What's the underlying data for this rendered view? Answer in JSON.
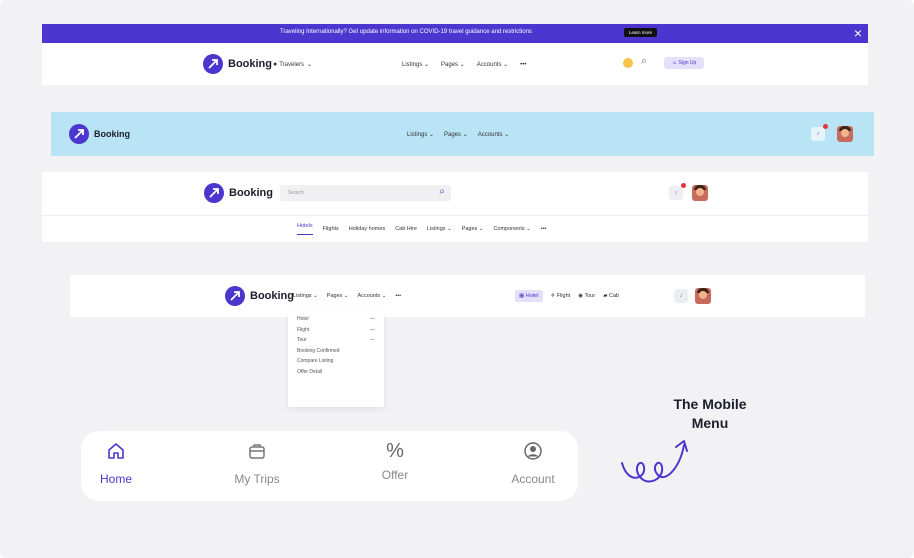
{
  "banner": {
    "text": "Traveling Internationally? Get update information on COVID-19 travel guidance and restrictions",
    "learn_more": "Learn more",
    "close_glyph": "×",
    "bg_color": "#4b37cf"
  },
  "brand": {
    "name": "Booking",
    "accent": "#4b37cf"
  },
  "header1": {
    "travelers": "Travelers",
    "nav": [
      "Listings",
      "Pages",
      "Accounts"
    ],
    "more": "•••",
    "signup": "Sign Up"
  },
  "header2": {
    "bg_color": "#b8e4f5",
    "nav": [
      "Listings",
      "Pages",
      "Accounts"
    ]
  },
  "header3": {
    "search_placeholder": "Search",
    "subnav": [
      "Hotels",
      "Flights",
      "Holiday homes",
      "Cab Hire",
      "Listings",
      "Pages",
      "Components",
      "•••"
    ]
  },
  "header4": {
    "nav": [
      "Listings",
      "Pages",
      "Accounts",
      "•••"
    ],
    "quick": [
      "Hotel",
      "Flight",
      "Tour",
      "Cab"
    ],
    "dropdown": [
      {
        "label": "Hotel",
        "arrow": "—"
      },
      {
        "label": "Flight",
        "arrow": "—"
      },
      {
        "label": "Tour",
        "arrow": "—"
      },
      {
        "label": "Booking Confirmed",
        "arrow": ""
      },
      {
        "label": "Compare Listing",
        "arrow": ""
      },
      {
        "label": "Offer Detail",
        "arrow": ""
      }
    ]
  },
  "mobile": {
    "caption_line1": "The Mobile",
    "caption_line2": "Menu",
    "tabs": [
      {
        "label": "Home",
        "icon": "home-icon",
        "active": true
      },
      {
        "label": "My Trips",
        "icon": "briefcase-icon",
        "active": false
      },
      {
        "label": "Offer",
        "icon": "percent-icon",
        "active": false
      },
      {
        "label": "Account",
        "icon": "user-circle-icon",
        "active": false
      }
    ]
  }
}
